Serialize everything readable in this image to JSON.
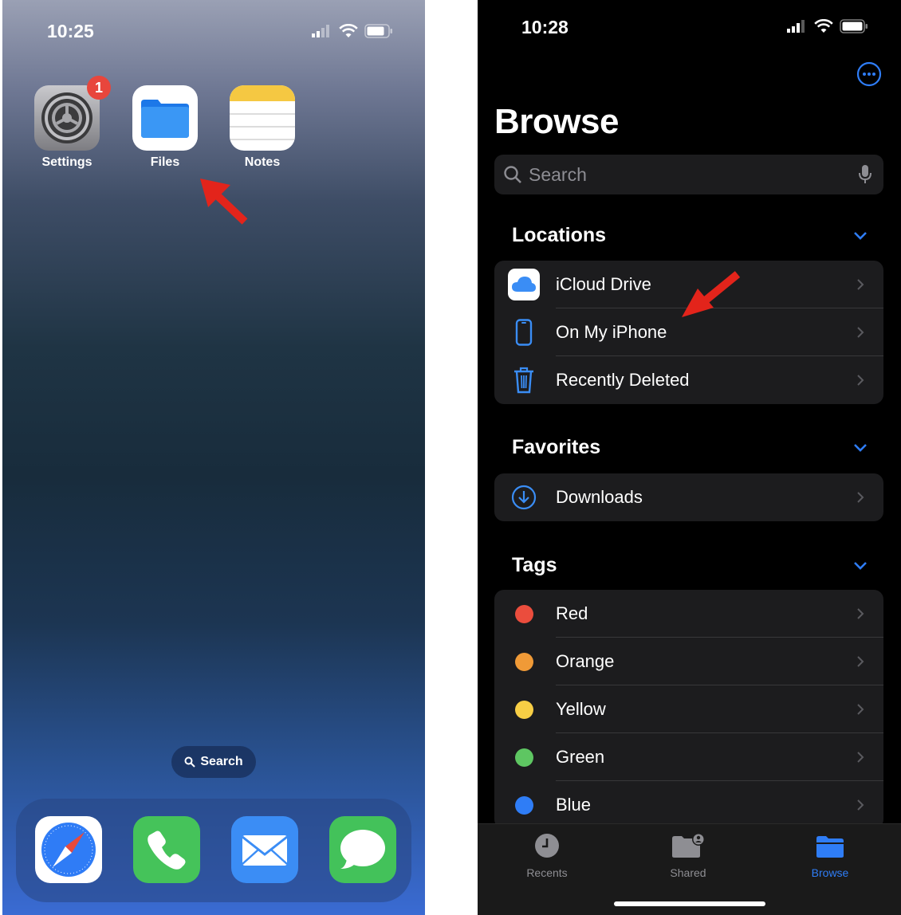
{
  "home_screen": {
    "status_time": "10:25",
    "apps": [
      {
        "name": "Settings",
        "badge": "1",
        "icon": "settings-gear-icon"
      },
      {
        "name": "Files",
        "icon": "files-folder-icon"
      },
      {
        "name": "Notes",
        "icon": "notes-icon"
      }
    ],
    "search_label": "Search",
    "dock": [
      {
        "icon": "safari-compass-icon",
        "color": "#2f7cf6"
      },
      {
        "icon": "phone-icon",
        "color": "#45c35a"
      },
      {
        "icon": "mail-icon",
        "color": "#3b8df5"
      },
      {
        "icon": "messages-icon",
        "color": "#43c25a"
      }
    ]
  },
  "files_app": {
    "status_time": "10:28",
    "title": "Browse",
    "search_placeholder": "Search",
    "sections": {
      "locations": {
        "header": "Locations",
        "items": [
          {
            "label": "iCloud Drive",
            "icon": "icloud-icon"
          },
          {
            "label": "On My iPhone",
            "icon": "iphone-icon"
          },
          {
            "label": "Recently Deleted",
            "icon": "trash-icon"
          }
        ]
      },
      "favorites": {
        "header": "Favorites",
        "items": [
          {
            "label": "Downloads",
            "icon": "download-circle-icon"
          }
        ]
      },
      "tags": {
        "header": "Tags",
        "items": [
          {
            "label": "Red",
            "color": "#eb4d3d"
          },
          {
            "label": "Orange",
            "color": "#f09a37"
          },
          {
            "label": "Yellow",
            "color": "#f7ce45"
          },
          {
            "label": "Green",
            "color": "#5ec662"
          },
          {
            "label": "Blue",
            "color": "#2f7df6"
          }
        ]
      }
    },
    "tabs": [
      {
        "label": "Recents",
        "icon": "clock-icon",
        "active": false
      },
      {
        "label": "Shared",
        "icon": "shared-folder-icon",
        "active": false
      },
      {
        "label": "Browse",
        "icon": "browse-folder-icon",
        "active": true
      }
    ],
    "colors": {
      "accent": "#2f7df6",
      "inactive": "#8e8e93"
    }
  }
}
